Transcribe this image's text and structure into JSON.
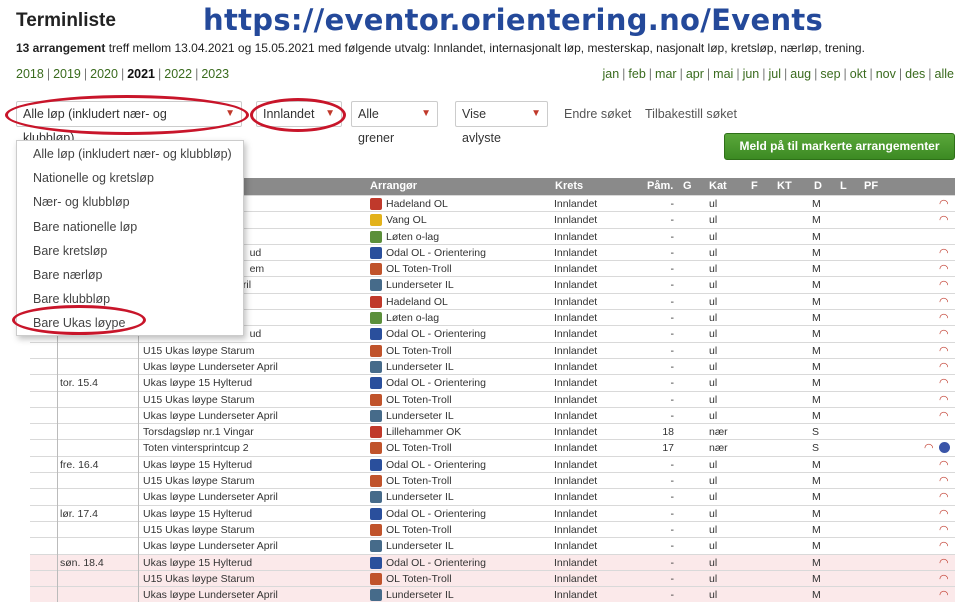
{
  "title": "Terminliste",
  "overlay_url": "https://eventor.orientering.no/Events",
  "summary": {
    "count": "13 arrangement",
    "text": " treff mellom 13.04.2021 og 15.05.2021 med følgende utvalg: Innlandet, internasjonalt løp, mesterskap, nasjonalt løp, kretsløp, nærløp, trening."
  },
  "years": [
    "2018",
    "2019",
    "2020",
    "2021",
    "2022",
    "2023"
  ],
  "current_year": "2021",
  "months": [
    "jan",
    "feb",
    "mar",
    "apr",
    "mai",
    "jun",
    "jul",
    "aug",
    "sep",
    "okt",
    "nov",
    "des",
    "alle"
  ],
  "filters": {
    "race_type": "Alle løp (inkludert nær- og klubbløp)",
    "district": "Innlandet",
    "discipline": "Alle grener",
    "cancelled": "Vise avlyste",
    "change_search": "Endre søket",
    "reset_search": "Tilbakestill søket"
  },
  "meld_button": "Meld på til markerte arrangementer",
  "dropdown": {
    "options": [
      "Alle løp (inkludert nær- og klubbløp)",
      "Nationelle og kretsløp",
      "Nær- og klubbløp",
      "Bare nationelle løp",
      "Bare kretsløp",
      "Bare nærløp",
      "Bare klubbløp",
      "Bare Ukas løype"
    ]
  },
  "columns": {
    "arranger": "Arrangør",
    "krets": "Krets",
    "pam": "Påm.",
    "g": "G",
    "kat": "Kat",
    "f": "F",
    "kt": "KT",
    "d": "D",
    "l": "L",
    "pf": "PF"
  },
  "rows": [
    {
      "date": "",
      "name": "",
      "partial": "",
      "org": "Hadeland OL",
      "krets": "Innlandet",
      "pam": "-",
      "kat": "ul",
      "d": "M",
      "act": true
    },
    {
      "date": "",
      "name": "",
      "partial": "",
      "org": "Vang OL",
      "krets": "Innlandet",
      "pam": "-",
      "kat": "ul",
      "d": "M",
      "act": true
    },
    {
      "date": "",
      "name": "",
      "partial": "",
      "org": "Løten o-lag",
      "krets": "Innlandet",
      "pam": "-",
      "kat": "ul",
      "d": "M",
      "act": false
    },
    {
      "date": "",
      "name": "",
      "partial": "ud",
      "org": "Odal OL - Orientering",
      "krets": "Innlandet",
      "pam": "-",
      "kat": "ul",
      "d": "M",
      "act": true
    },
    {
      "date": "",
      "name": "",
      "partial": "em",
      "org": "OL Toten-Troll",
      "krets": "Innlandet",
      "pam": "-",
      "kat": "ul",
      "d": "M",
      "act": true
    },
    {
      "date": "",
      "name": "",
      "partial": "er April",
      "org": "Lunderseter IL",
      "krets": "Innlandet",
      "pam": "-",
      "kat": "ul",
      "d": "M",
      "act": true
    },
    {
      "date": "",
      "name": "",
      "partial": "",
      "org": "Hadeland OL",
      "krets": "Innlandet",
      "pam": "-",
      "kat": "ul",
      "d": "M",
      "act": true
    },
    {
      "date": "",
      "name": "",
      "partial": "",
      "org": "Løten o-lag",
      "krets": "Innlandet",
      "pam": "-",
      "kat": "ul",
      "d": "M",
      "act": true
    },
    {
      "date": "",
      "name": "",
      "partial": "ud",
      "org": "Odal OL - Orientering",
      "krets": "Innlandet",
      "pam": "-",
      "kat": "ul",
      "d": "M",
      "act": true
    },
    {
      "date": "",
      "name": "U15 Ukas løype Starum",
      "partial": "",
      "org": "OL Toten-Troll",
      "krets": "Innlandet",
      "pam": "-",
      "kat": "ul",
      "d": "M",
      "act": true
    },
    {
      "date": "",
      "name": "Ukas løype Lunderseter April",
      "partial": "",
      "org": "Lunderseter IL",
      "krets": "Innlandet",
      "pam": "-",
      "kat": "ul",
      "d": "M",
      "act": true
    },
    {
      "date": "tor. 15.4",
      "name": "Ukas løype 15 Hylterud",
      "partial": "",
      "org": "Odal OL - Orientering",
      "krets": "Innlandet",
      "pam": "-",
      "kat": "ul",
      "d": "M",
      "act": true
    },
    {
      "date": "",
      "name": "U15 Ukas løype Starum",
      "partial": "",
      "org": "OL Toten-Troll",
      "krets": "Innlandet",
      "pam": "-",
      "kat": "ul",
      "d": "M",
      "act": true
    },
    {
      "date": "",
      "name": "Ukas løype Lunderseter April",
      "partial": "",
      "org": "Lunderseter IL",
      "krets": "Innlandet",
      "pam": "-",
      "kat": "ul",
      "d": "M",
      "act": true
    },
    {
      "date": "",
      "name": "Torsdagsløp nr.1 Vingar",
      "partial": "",
      "org": "Lillehammer OK",
      "krets": "Innlandet",
      "pam": "18",
      "kat": "nær",
      "d": "S",
      "act": false
    },
    {
      "date": "",
      "name": "Toten vintersprintcup 2",
      "partial": "",
      "org": "OL Toten-Troll",
      "krets": "Innlandet",
      "pam": "17",
      "kat": "nær",
      "d": "S",
      "act": true,
      "globe": true
    },
    {
      "date": "fre. 16.4",
      "name": "Ukas løype 15 Hylterud",
      "partial": "",
      "org": "Odal OL - Orientering",
      "krets": "Innlandet",
      "pam": "-",
      "kat": "ul",
      "d": "M",
      "act": true
    },
    {
      "date": "",
      "name": "U15 Ukas løype Starum",
      "partial": "",
      "org": "OL Toten-Troll",
      "krets": "Innlandet",
      "pam": "-",
      "kat": "ul",
      "d": "M",
      "act": true
    },
    {
      "date": "",
      "name": "Ukas løype Lunderseter April",
      "partial": "",
      "org": "Lunderseter IL",
      "krets": "Innlandet",
      "pam": "-",
      "kat": "ul",
      "d": "M",
      "act": true
    },
    {
      "date": "lør. 17.4",
      "name": "Ukas løype 15 Hylterud",
      "partial": "",
      "org": "Odal OL - Orientering",
      "krets": "Innlandet",
      "pam": "-",
      "kat": "ul",
      "d": "M",
      "act": true
    },
    {
      "date": "",
      "name": "U15 Ukas løype Starum",
      "partial": "",
      "org": "OL Toten-Troll",
      "krets": "Innlandet",
      "pam": "-",
      "kat": "ul",
      "d": "M",
      "act": true
    },
    {
      "date": "",
      "name": "Ukas løype Lunderseter April",
      "partial": "",
      "org": "Lunderseter IL",
      "krets": "Innlandet",
      "pam": "-",
      "kat": "ul",
      "d": "M",
      "act": true
    },
    {
      "date": "søn. 18.4",
      "name": "Ukas løype 15 Hylterud",
      "partial": "",
      "org": "Odal OL - Orientering",
      "krets": "Innlandet",
      "pam": "-",
      "kat": "ul",
      "d": "M",
      "act": true,
      "pink": true
    },
    {
      "date": "",
      "name": "U15 Ukas løype Starum",
      "partial": "",
      "org": "OL Toten-Troll",
      "krets": "Innlandet",
      "pam": "-",
      "kat": "ul",
      "d": "M",
      "act": true,
      "pink": true
    },
    {
      "date": "",
      "name": "Ukas løype Lunderseter April",
      "partial": "",
      "org": "Lunderseter IL",
      "krets": "Innlandet",
      "pam": "-",
      "kat": "ul",
      "d": "M",
      "act": true,
      "pink": true
    }
  ],
  "colors": {
    "link_green": "#3a6b1e",
    "highlight_red": "#c8152a",
    "url_blue": "#24499a",
    "button_green": "#3c8a23"
  }
}
